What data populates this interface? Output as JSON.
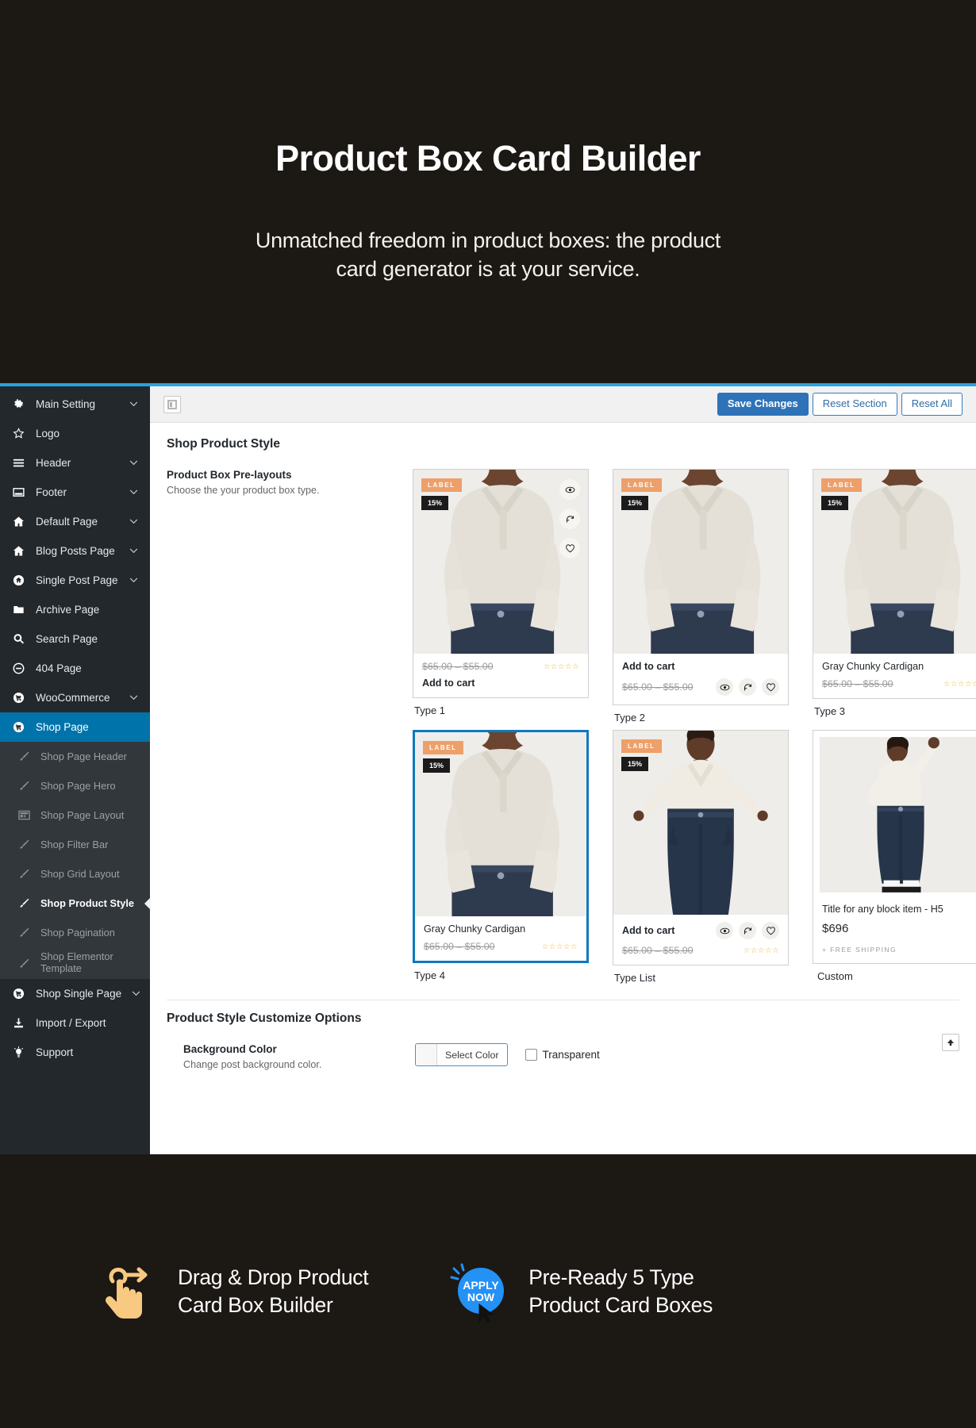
{
  "hero": {
    "title": "Product Box Card Builder",
    "subtitle_line1": "Unmatched freedom in product boxes: the product",
    "subtitle_line2": "card generator is at your service."
  },
  "sidebar": {
    "items": [
      {
        "label": "Main Setting",
        "icon": "gear-icon",
        "chevron": true,
        "type": "top"
      },
      {
        "label": "Logo",
        "icon": "star-icon",
        "chevron": false,
        "type": "top"
      },
      {
        "label": "Header",
        "icon": "menu-icon",
        "chevron": true,
        "type": "top"
      },
      {
        "label": "Footer",
        "icon": "window-icon",
        "chevron": true,
        "type": "top"
      },
      {
        "label": "Default Page",
        "icon": "home-icon",
        "chevron": true,
        "type": "top"
      },
      {
        "label": "Blog Posts Page",
        "icon": "home-icon",
        "chevron": true,
        "type": "top"
      },
      {
        "label": "Single Post Page",
        "icon": "home-circle-icon",
        "chevron": true,
        "type": "top"
      },
      {
        "label": "Archive Page",
        "icon": "folder-icon",
        "chevron": false,
        "type": "top"
      },
      {
        "label": "Search Page",
        "icon": "search-icon",
        "chevron": false,
        "type": "top"
      },
      {
        "label": "404 Page",
        "icon": "minus-circle-icon",
        "chevron": false,
        "type": "top"
      },
      {
        "label": "WooCommerce",
        "icon": "cart-circle-icon",
        "chevron": true,
        "type": "top"
      },
      {
        "label": "Shop Page",
        "icon": "cart-circle-icon",
        "chevron": false,
        "type": "active"
      },
      {
        "label": "Shop Page Header",
        "icon": "brush-icon",
        "chevron": false,
        "type": "sub"
      },
      {
        "label": "Shop Page Hero",
        "icon": "brush-icon",
        "chevron": false,
        "type": "sub"
      },
      {
        "label": "Shop Page Layout",
        "icon": "layout-icon",
        "chevron": false,
        "type": "sub"
      },
      {
        "label": "Shop Filter Bar",
        "icon": "brush-icon",
        "chevron": false,
        "type": "sub"
      },
      {
        "label": "Shop Grid Layout",
        "icon": "brush-icon",
        "chevron": false,
        "type": "sub"
      },
      {
        "label": "Shop Product Style",
        "icon": "brush-icon",
        "chevron": false,
        "type": "sub-current"
      },
      {
        "label": "Shop Pagination",
        "icon": "brush-icon",
        "chevron": false,
        "type": "sub"
      },
      {
        "label": "Shop Elementor Template",
        "icon": "brush-icon",
        "chevron": false,
        "type": "sub-two-line"
      },
      {
        "label": "Shop Single Page",
        "icon": "cart-circle-icon",
        "chevron": true,
        "type": "top"
      },
      {
        "label": "Import / Export",
        "icon": "download-icon",
        "chevron": false,
        "type": "top"
      },
      {
        "label": "Support",
        "icon": "bulb-icon",
        "chevron": false,
        "type": "top"
      }
    ]
  },
  "toolbar": {
    "expand_icon": "expand-panel-icon",
    "save_label": "Save Changes",
    "reset_section_label": "Reset Section",
    "reset_all_label": "Reset All"
  },
  "main": {
    "page_title": "Shop Product Style",
    "prelayouts": {
      "label": "Product Box Pre-layouts",
      "description": "Choose the your product box type.",
      "scroll_top_icon": "scroll-to-top-icon"
    },
    "cards": [
      {
        "caption": "Type 1",
        "badge_label": "LABEL",
        "badge_pct": "15%",
        "title": "",
        "price": "$65.00 – $55.00",
        "add_to_cart": "Add to cart",
        "stars": "☆☆☆☆☆",
        "icons": [
          "eye-icon",
          "compare-icon",
          "heart-icon"
        ],
        "icons_position": "overlay-right",
        "selected": false
      },
      {
        "caption": "Type 2",
        "badge_label": "LABEL",
        "badge_pct": "15%",
        "title": "",
        "price": "$65.00 – $55.00",
        "add_to_cart": "Add to cart",
        "stars": "",
        "icons": [
          "eye-icon",
          "compare-icon",
          "heart-icon"
        ],
        "icons_position": "inline-bottom",
        "selected": false
      },
      {
        "caption": "Type 3",
        "badge_label": "LABEL",
        "badge_pct": "15%",
        "title": "Gray Chunky Cardigan",
        "price": "$65.00 – $55.00",
        "add_to_cart": "",
        "stars": "☆☆☆☆☆",
        "icons": [],
        "icons_position": "none",
        "selected": false
      },
      {
        "caption": "Type 4",
        "badge_label": "LABEL",
        "badge_pct": "15%",
        "title": "Gray Chunky Cardigan",
        "price": "$65.00 – $55.00",
        "add_to_cart": "",
        "stars": "☆☆☆☆☆",
        "icons": [],
        "icons_position": "none",
        "selected": true
      },
      {
        "caption": "Type List",
        "badge_label": "LABEL",
        "badge_pct": "15%",
        "title": "",
        "price": "$65.00 – $55.00",
        "add_to_cart": "Add to cart",
        "stars": "☆☆☆☆☆",
        "icons": [
          "eye-icon",
          "compare-icon",
          "heart-icon"
        ],
        "icons_position": "inline-bottom",
        "selected": false
      }
    ],
    "custom_card": {
      "caption": "Custom",
      "title": "Title for any block item - H5",
      "price": "$696",
      "shipping": "+ FREE SHIPPING"
    },
    "customize": {
      "title": "Product Style Customize Options",
      "bg_color_label": "Background Color",
      "bg_color_desc": "Change post background color.",
      "select_color_label": "Select Color",
      "transparent_label": "Transparent",
      "scroll_top_icon": "scroll-to-top-icon"
    }
  },
  "features": [
    {
      "icon": "drag-hand-icon",
      "line1": "Drag & Drop Product",
      "line2": "Card Box Builder"
    },
    {
      "icon": "apply-now-badge-icon",
      "line1": "Pre-Ready 5 Type",
      "line2": "Product Card Boxes"
    }
  ],
  "colors": {
    "accent": "#2aa3e0",
    "sidebar_bg": "#23282d",
    "active": "#0073aa",
    "badge": "#eda06a",
    "star": "#f0b429"
  }
}
